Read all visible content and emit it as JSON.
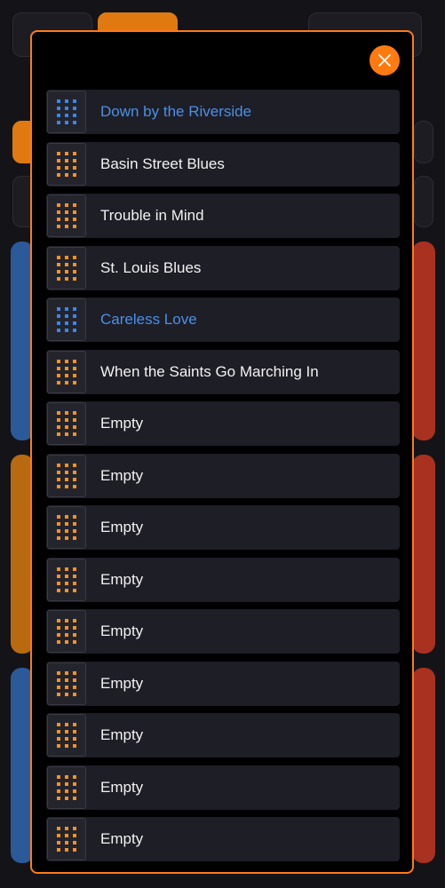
{
  "colors": {
    "accent": "#ff7b10",
    "active_text": "#4a90e6",
    "active_grip": "#3c86e8",
    "grip": "#f39323",
    "text": "#f2f2f2",
    "row_bg": "#1e1e27"
  },
  "modal": {
    "close_icon": "close-icon"
  },
  "slots": [
    {
      "label": "Down by the Riverside",
      "active": true
    },
    {
      "label": "Basin Street Blues",
      "active": false
    },
    {
      "label": "Trouble in Mind",
      "active": false
    },
    {
      "label": "St. Louis Blues",
      "active": false
    },
    {
      "label": "Careless Love",
      "active": true
    },
    {
      "label": "When the Saints Go Marching In",
      "active": false
    },
    {
      "label": "Empty",
      "active": false
    },
    {
      "label": "Empty",
      "active": false
    },
    {
      "label": "Empty",
      "active": false
    },
    {
      "label": "Empty",
      "active": false
    },
    {
      "label": "Empty",
      "active": false
    },
    {
      "label": "Empty",
      "active": false
    },
    {
      "label": "Empty",
      "active": false
    },
    {
      "label": "Empty",
      "active": false
    },
    {
      "label": "Empty",
      "active": false
    }
  ]
}
